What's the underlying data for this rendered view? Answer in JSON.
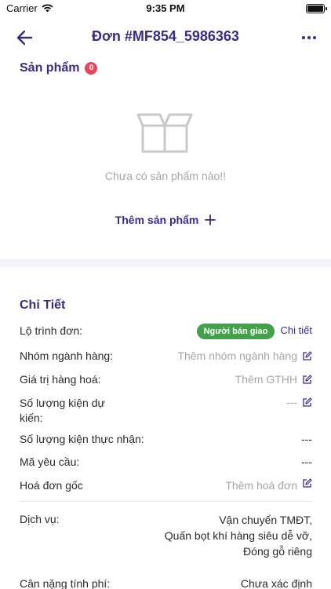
{
  "status_bar": {
    "carrier": "Carrier",
    "time": "9:35 PM",
    "icons": [
      "wifi-icon",
      "battery-icon"
    ]
  },
  "header": {
    "title": "Đơn #MF854_5986363",
    "back_icon": "arrow-left-icon",
    "more_icon": "more-horizontal-icon"
  },
  "products": {
    "title": "Sản phẩm",
    "count": "0",
    "empty_icon": "empty-box-icon",
    "empty_text": "Chưa có sản phẩm nào!!",
    "add_label": "Thêm sản phẩm",
    "add_icon": "plus-icon"
  },
  "details": {
    "title": "Chi Tiết",
    "route": {
      "label": "Lộ trình đơn:",
      "badge": "Người bán giao",
      "link": "Chi tiết"
    },
    "category": {
      "label": "Nhóm ngành hàng:",
      "placeholder": "Thêm nhóm ngành hàng"
    },
    "goods_value": {
      "label": "Giá trị hàng hoá:",
      "placeholder": "Thêm GTHH"
    },
    "expected_packages": {
      "label_line1": "Số lượng kiện dự",
      "label_line2": "kiến:",
      "value": "---"
    },
    "received_packages": {
      "label": "Số lượng kiện thực nhận:",
      "value": "---"
    },
    "request_code": {
      "label": "Mã yêu cầu:",
      "value": "---"
    },
    "original_invoice": {
      "label": "Hoá đơn gốc",
      "placeholder": "Thêm hoá đơn"
    },
    "services": {
      "label": "Dịch vụ:",
      "lines": [
        "Vận chuyển TMĐT,",
        "Quấn bọt khí hàng siêu dễ vỡ,",
        "Đóng gỗ riêng"
      ]
    },
    "chargeable_weight": {
      "label": "Cân nặng tính phí:",
      "value": "Chưa xác định"
    }
  },
  "colors": {
    "primary": "#3b2a86",
    "badge_red": "#e8455a",
    "badge_green": "#43a14b",
    "placeholder": "#a6a6a6",
    "divider": "#f1f4fb"
  }
}
